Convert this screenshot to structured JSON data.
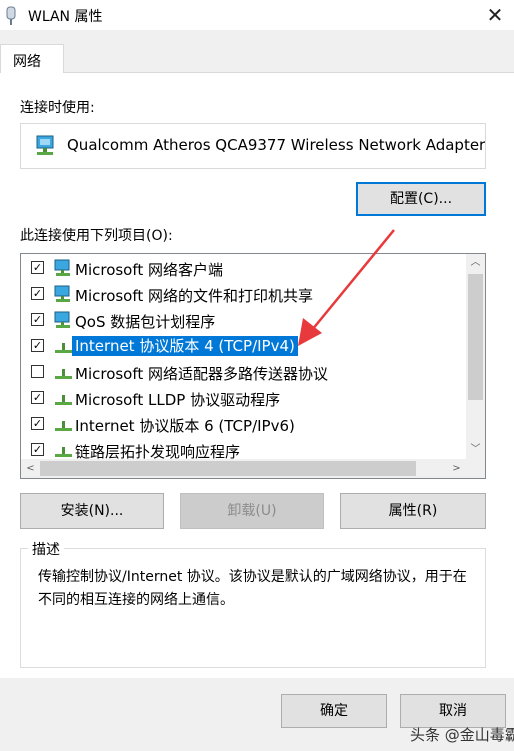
{
  "window": {
    "title": "WLAN 属性",
    "close_symbol": "✕"
  },
  "tabs": [
    {
      "label": "网络"
    }
  ],
  "connect_using_label": "连接时使用:",
  "adapter": {
    "icon": "network-adapter-icon",
    "name": "Qualcomm Atheros QCA9377 Wireless Network Adapter"
  },
  "configure_button": "配置(C)...",
  "items_label": "此连接使用下列项目(O):",
  "items": [
    {
      "label": "Microsoft 网络客户端",
      "checked": true,
      "icon": "network-client-icon"
    },
    {
      "label": "Microsoft 网络的文件和打印机共享",
      "checked": true,
      "icon": "network-client-icon"
    },
    {
      "label": "QoS 数据包计划程序",
      "checked": true,
      "icon": "network-client-icon"
    },
    {
      "label": "Internet 协议版本 4 (TCP/IPv4)",
      "checked": true,
      "icon": "protocol-icon",
      "selected": true
    },
    {
      "label": "Microsoft 网络适配器多路传送器协议",
      "checked": false,
      "icon": "protocol-icon"
    },
    {
      "label": "Microsoft LLDP 协议驱动程序",
      "checked": true,
      "icon": "protocol-icon"
    },
    {
      "label": "Internet 协议版本 6 (TCP/IPv6)",
      "checked": true,
      "icon": "protocol-icon"
    },
    {
      "label": "链路层拓扑发现响应程序",
      "checked": true,
      "icon": "protocol-icon"
    }
  ],
  "scroll_symbols": {
    "up": "︿",
    "down": "﹀",
    "left": "<",
    "right": ">"
  },
  "buttons": {
    "install": "安装(N)...",
    "uninstall": "卸载(U)",
    "properties": "属性(R)"
  },
  "description": {
    "title": "描述",
    "text": "传输控制协议/Internet 协议。该协议是默认的广域网络协议，用于在不同的相互连接的网络上通信。"
  },
  "footer": {
    "ok": "确定",
    "cancel": "取消"
  },
  "watermark": "头条 @金山毒霸",
  "colors": {
    "selection": "#0078d7",
    "annotation_arrow": "#e8393c"
  }
}
